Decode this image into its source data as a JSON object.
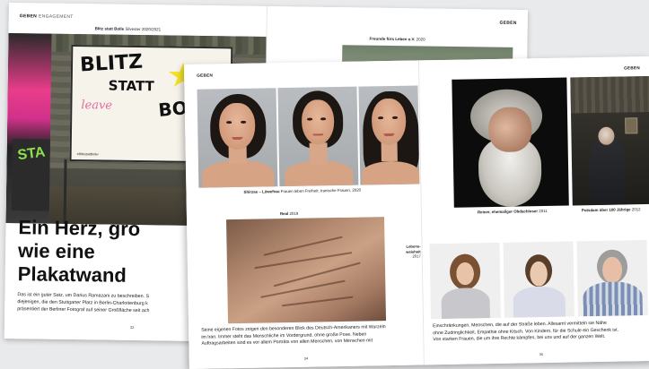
{
  "back_spread": {
    "left_page": {
      "section_label": "GEBEN",
      "section_sub": "ENGAGEMENT",
      "photo_caption_bold": "Blitz statt Bolle",
      "photo_caption_rest": "Silvester 2020/2021",
      "billboard_line1": "BLITZ",
      "billboard_line2": "STATT",
      "billboard_line3": "BOLLE",
      "billboard_pink": "leave",
      "billboard_small": "#BlitzstattBöller",
      "graffiti_green": "STA",
      "title": "Ein Herz, gro\nwie eine\nPlakatwand",
      "body": "Das ist ein guter Satz, um Darius Ramazani zu beschreiben. S\ndiejenigen, die den Stuttgarter Platz in Berlin-Charlottenburg k\npräsentiert der Berliner Fotograf auf seiner Großfläche seit ach",
      "page_number": "32"
    },
    "right_page": {
      "section_label": "GEBEN",
      "photo_caption_bold": "Freunde fürs Leben e.V.",
      "photo_caption_rest": "2020"
    }
  },
  "front_spread": {
    "left_page": {
      "section_label": "GEBEN",
      "caption1_bold": "Shirzae – Löwefrau",
      "caption1_rest": "Frauen leben Freiheit, Iranische Frauen, 2020",
      "caption2_bold": "Real",
      "caption2_rest": "2019",
      "side_label_bold": "Lebens-\nweisheit",
      "side_label_year": "2017",
      "body": "Seine eigenen Fotos zeigen den besonderen Blick des Deutsch-Amerikaners mit Wurzeln\nim Iran. Immer steht das Menschliche im Vordergrund, ohne große Pose. Neben\nAuftragsarbeiten sind es vor allem Porträts von allen Menschen, von Menschen mit",
      "page_number": "34"
    },
    "right_page": {
      "section_label": "GEBEN",
      "caption3_bold": "Reiner, ehemaliger Obdachloser",
      "caption3_rest": "2011",
      "caption4_bold": "Potsdam über 100 Jährige",
      "caption4_rest": "2012",
      "body": "Einschränkungen, Menschen, die auf der Straße leben. Allesamt vermitteln sie Nähe\nohne Zudringlichkeit, Empathie ohne Kitsch. Von Kindern, für die Schule ein Geschenk ist.\nVon starken Frauen, die um ihre Rechte kämpfen, bei uns und auf der ganzen Welt.",
      "page_number": "35"
    }
  },
  "colors": {
    "background": "#e9eaec",
    "text": "#111111",
    "graffiti_pink": "#ea3c8a",
    "graffiti_green": "#8ee24b",
    "star_yellow": "#f3e22a"
  }
}
